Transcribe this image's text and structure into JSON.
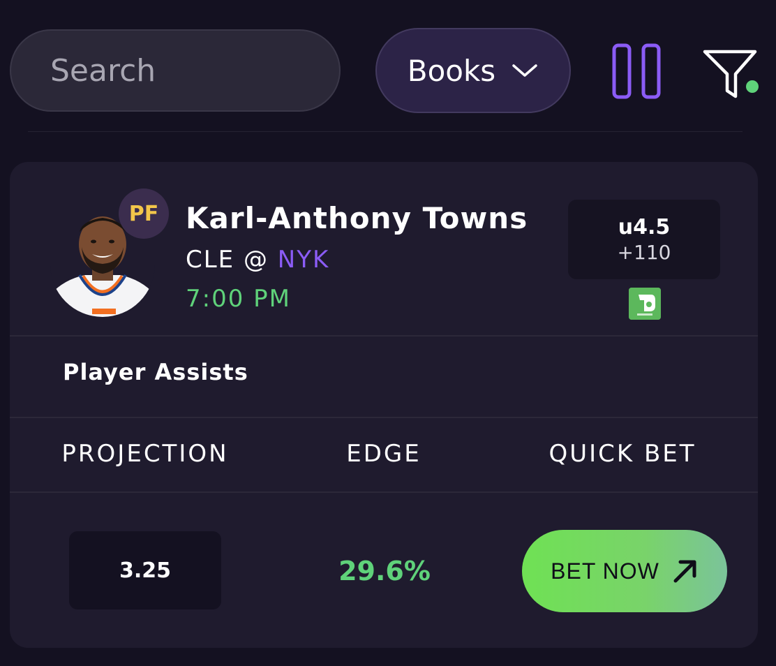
{
  "search": {
    "placeholder": "Search",
    "value": ""
  },
  "books_dropdown": {
    "label": "Books",
    "icon": "chevron-down-icon"
  },
  "toolbar": {
    "pause_icon": "pause-icon",
    "filter_icon": "filter-icon",
    "accent": "#8b5cf6",
    "filter_dot_color": "#5fd27a"
  },
  "card": {
    "player": {
      "name": "Karl-Anthony Towns",
      "position": "PF",
      "away_team": "CLE",
      "at": "@",
      "home_team": "NYK",
      "time": "7:00 PM"
    },
    "line": {
      "value": "u4.5",
      "odds": "+110"
    },
    "sportsbook_icon": "draftkings-logo-icon",
    "market": "Player Assists",
    "columns": [
      "PROJECTION",
      "EDGE",
      "QUICK BET"
    ],
    "projection": "3.25",
    "edge": "29.6%",
    "bet_button": {
      "label": "BET NOW",
      "icon": "arrow-up-right-icon"
    }
  },
  "colors": {
    "background": "#141121",
    "card": "#1f1b2e",
    "positive": "#5fd27a",
    "home_team": "#8b5cf6",
    "badge_text": "#f3c64a"
  }
}
